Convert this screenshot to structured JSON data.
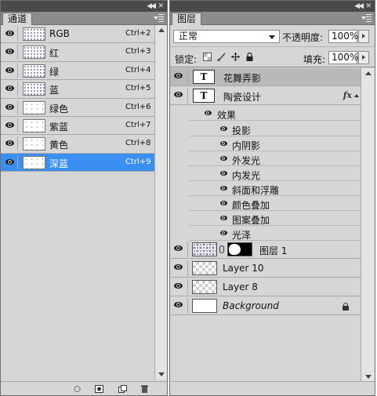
{
  "channels_panel": {
    "tab_label": "通道",
    "collapse_icon": "double-chevron-left-icon",
    "close_icon": "close-icon",
    "menu_icon": "panel-menu-icon",
    "selected_color": "#3b8ff3",
    "rows": [
      {
        "name": "RGB",
        "shortcut": "Ctrl+2",
        "visible": true
      },
      {
        "name": "红",
        "shortcut": "Ctrl+3",
        "visible": true
      },
      {
        "name": "绿",
        "shortcut": "Ctrl+4",
        "visible": true
      },
      {
        "name": "蓝",
        "shortcut": "Ctrl+5",
        "visible": true
      },
      {
        "name": "绿色",
        "shortcut": "Ctrl+6",
        "visible": true
      },
      {
        "name": "紫蓝",
        "shortcut": "Ctrl+7",
        "visible": true
      },
      {
        "name": "黄色",
        "shortcut": "Ctrl+8",
        "visible": true
      },
      {
        "name": "深蓝",
        "shortcut": "Ctrl+9",
        "visible": true,
        "selected": true
      }
    ],
    "bottom_icons": [
      "load-selection-icon",
      "save-selection-icon",
      "new-channel-icon",
      "trash-icon"
    ]
  },
  "layers_panel": {
    "tab_label": "图层",
    "blend_mode": "正常",
    "opacity_label": "不透明度:",
    "opacity_value": "100%",
    "lock_label": "锁定:",
    "fill_label": "填充:",
    "fill_value": "100%",
    "lock_icons": [
      "lock-transparency-icon",
      "lock-brush-icon",
      "lock-move-icon",
      "lock-all-icon"
    ],
    "layers": [
      {
        "name": "花舞弄影",
        "type": "text",
        "thumb_text": "T",
        "selected": true
      },
      {
        "name": "陶瓷设计",
        "type": "text",
        "thumb_text": "T",
        "fx": "fx"
      },
      {
        "name": "图层 1",
        "type": "masked-image"
      },
      {
        "name": "Layer 10",
        "type": "image"
      },
      {
        "name": "Layer 8",
        "type": "image"
      },
      {
        "name": "Background",
        "type": "background",
        "locked": true
      }
    ],
    "effects_label": "效果",
    "effects": [
      "投影",
      "内阴影",
      "外发光",
      "内发光",
      "斜面和浮雕",
      "颜色叠加",
      "图案叠加",
      "光泽"
    ]
  }
}
